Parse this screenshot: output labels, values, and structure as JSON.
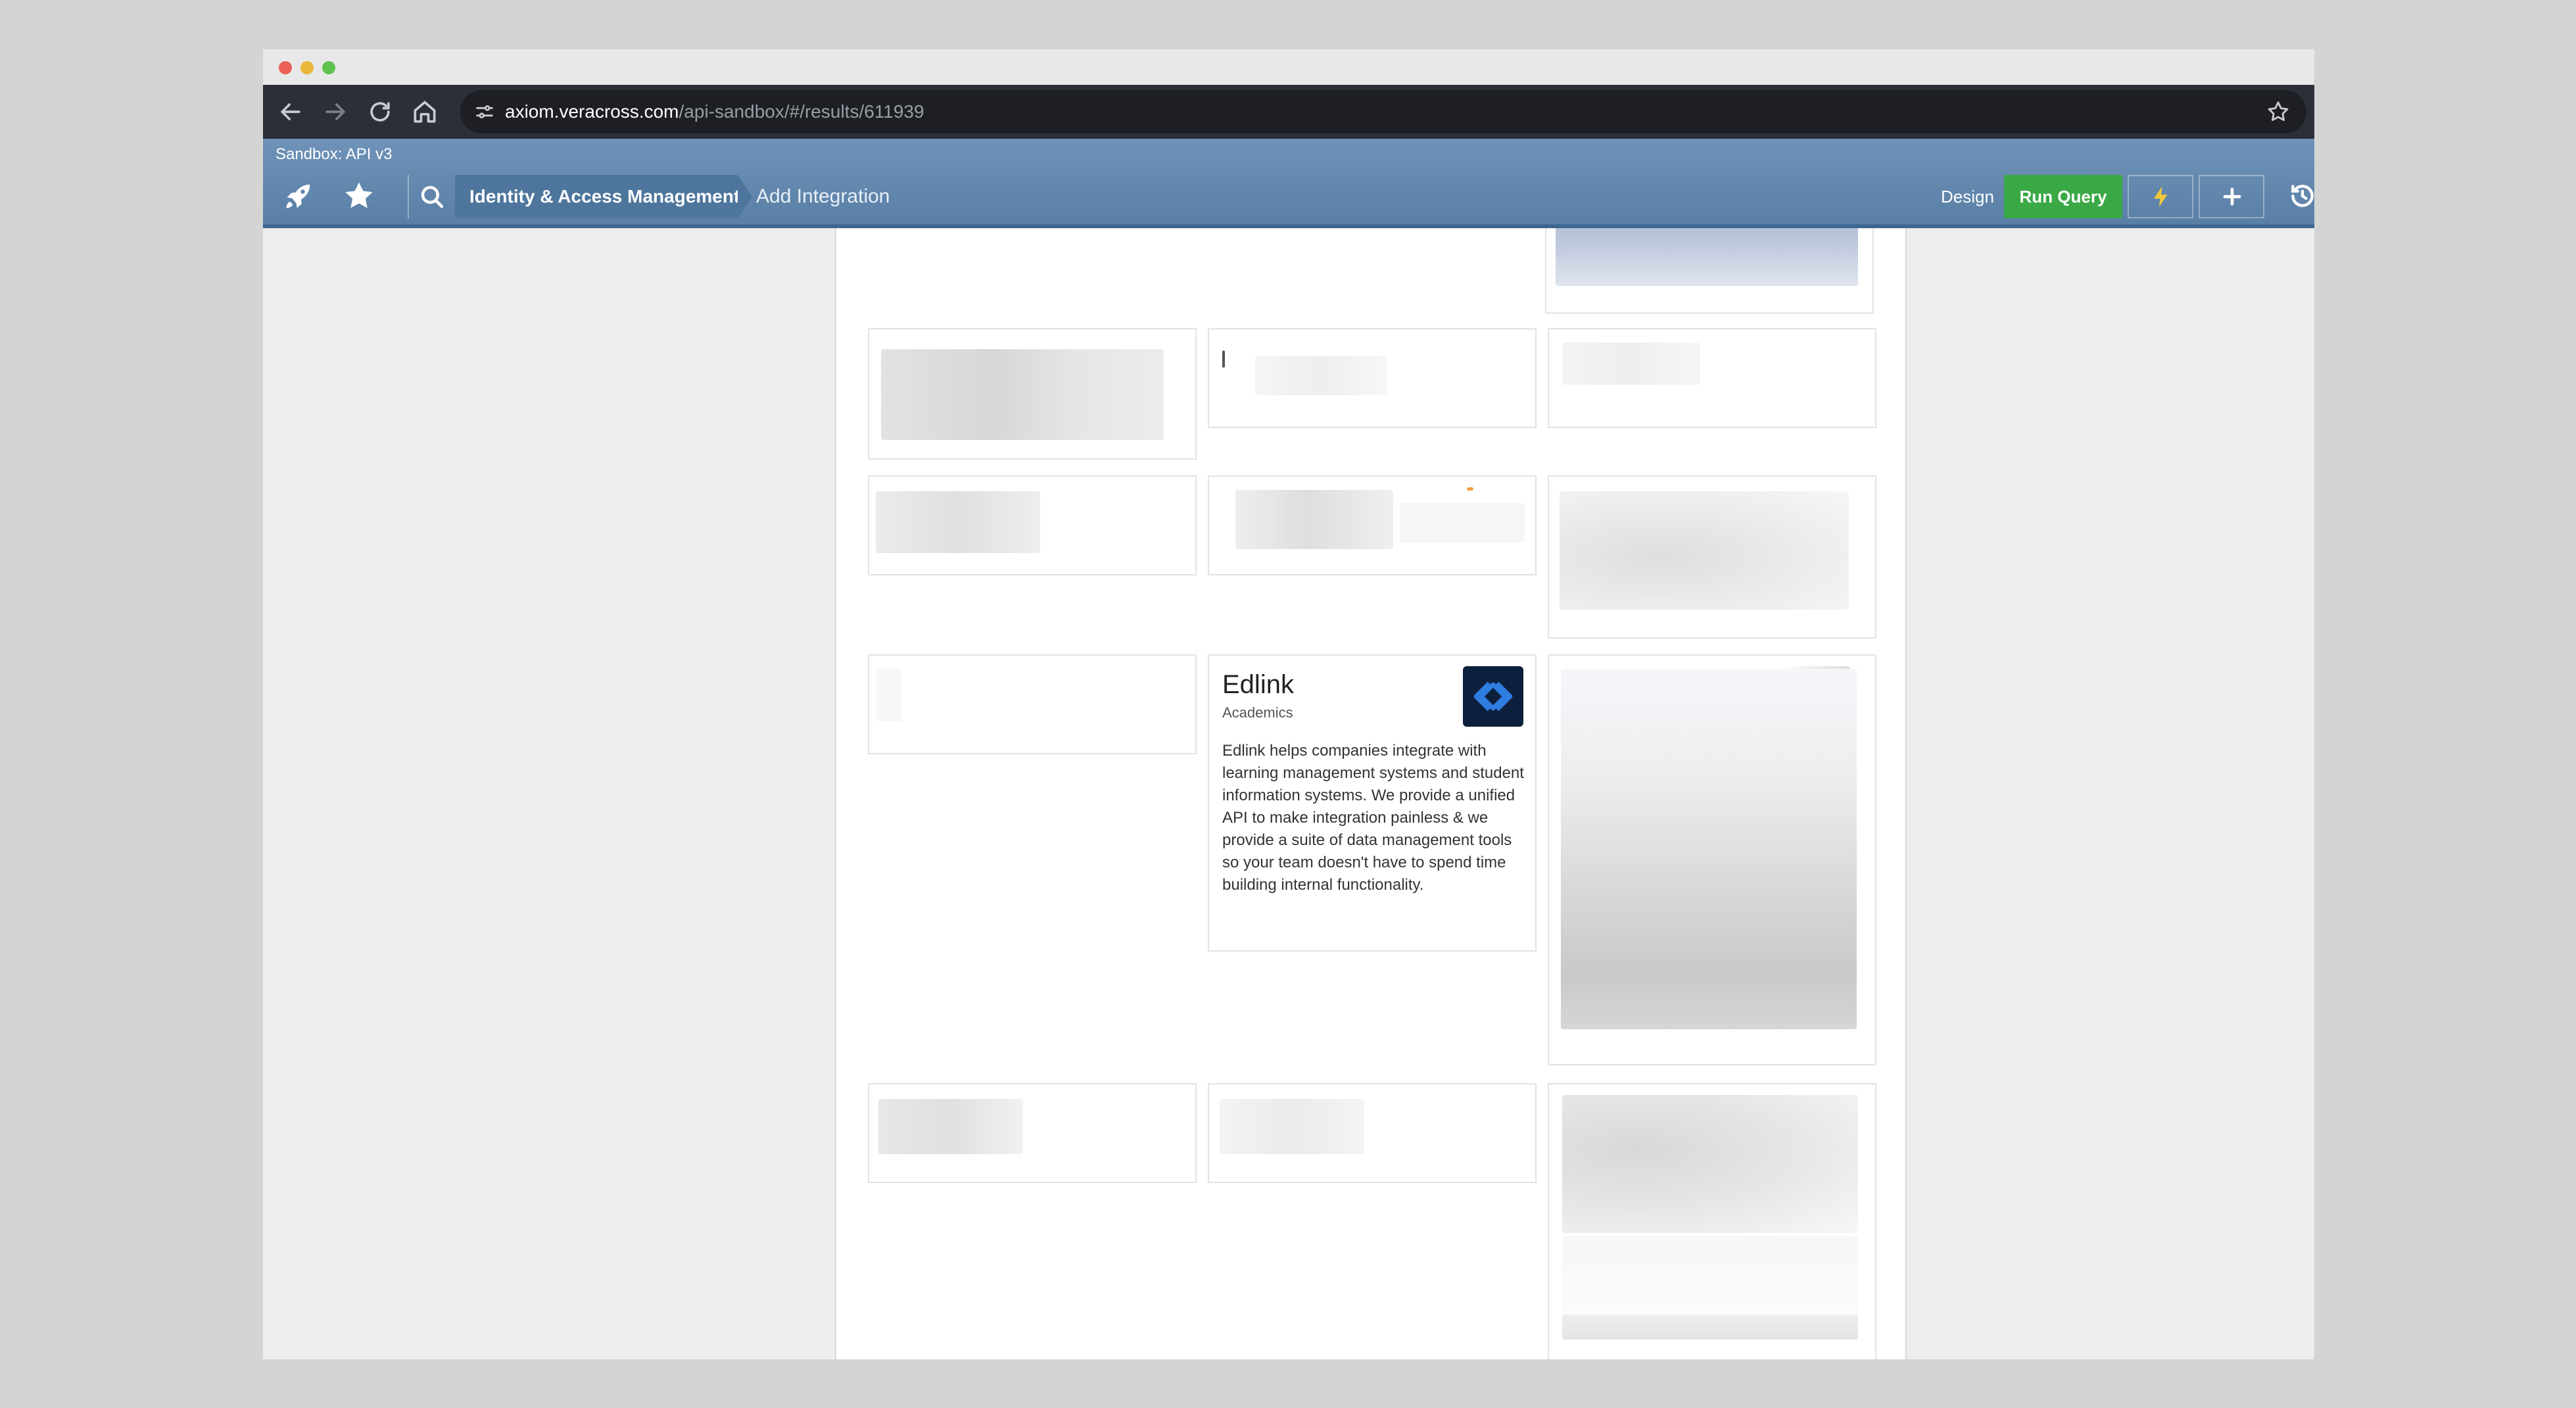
{
  "browser": {
    "url_host": "axiom.veracross.com",
    "url_path": "/api-sandbox/#/results/611939"
  },
  "app": {
    "sandbox_label": "Sandbox: API v3",
    "breadcrumb_primary": "Identity & Access Management",
    "breadcrumb_secondary": "Add Integration",
    "design_label": "Design",
    "run_query_label": "Run Query"
  },
  "integration_card": {
    "title": "Edlink",
    "category": "Academics",
    "description": "Edlink helps companies integrate with learning management systems and student information systems. We provide a unified API to make integration painless & we provide a suite of data management tools so your team doesn't have to spend time building internal functionality."
  },
  "icons": {
    "back": "back-arrow-icon",
    "forward": "forward-arrow-icon",
    "reload": "reload-icon",
    "home": "home-icon",
    "site_settings": "site-settings-icon",
    "bookmark": "bookmark-star-icon",
    "rocket": "rocket-icon",
    "favorites": "star-icon",
    "search": "search-icon",
    "bolt": "lightning-bolt-icon",
    "plus": "plus-icon",
    "history": "history-icon",
    "edlink_logo": "edlink-logo-icon"
  },
  "colors": {
    "run_query": "#3aa945",
    "header": "#5a7fa6",
    "edlink_logo_bg": "#0c1f3d",
    "edlink_logo_fg": "#2f7de1"
  }
}
